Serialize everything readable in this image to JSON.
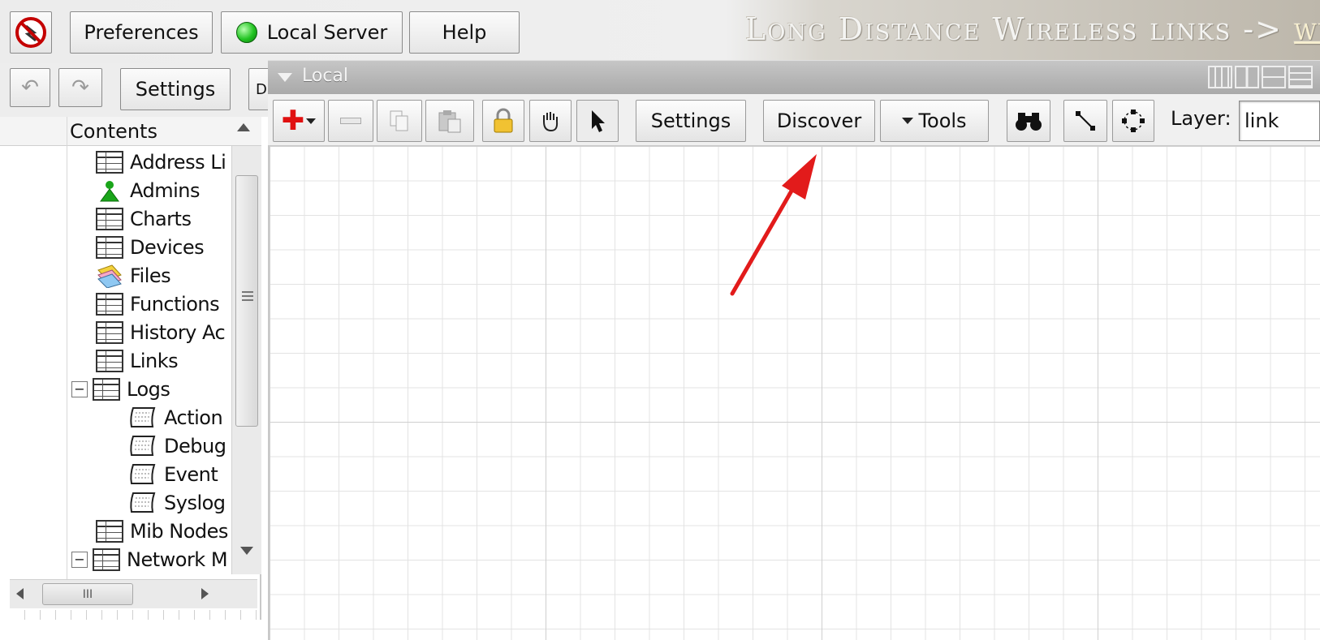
{
  "topbar": {
    "preferences_label": "Preferences",
    "server_label": "Local Server",
    "help_label": "Help",
    "banner_text": "Long Distance Wireless links -> ",
    "banner_link": "www"
  },
  "toolbar2": {
    "settings_label": "Settings",
    "cut_char": "D"
  },
  "tree": {
    "header": "Contents",
    "items": [
      {
        "label": "Address Li",
        "icon": "table-icon"
      },
      {
        "label": "Admins",
        "icon": "admin-icon"
      },
      {
        "label": "Charts",
        "icon": "table-icon"
      },
      {
        "label": "Devices",
        "icon": "table-icon"
      },
      {
        "label": "Files",
        "icon": "files-icon"
      },
      {
        "label": "Functions",
        "icon": "table-icon"
      },
      {
        "label": "History Ac",
        "icon": "table-icon"
      },
      {
        "label": "Links",
        "icon": "table-icon"
      },
      {
        "label": "Logs",
        "icon": "table-icon"
      },
      {
        "label": "Action",
        "icon": "log-icon"
      },
      {
        "label": "Debug",
        "icon": "log-icon"
      },
      {
        "label": "Event",
        "icon": "log-icon"
      },
      {
        "label": "Syslog",
        "icon": "log-icon"
      },
      {
        "label": "Mib Nodes",
        "icon": "table-icon"
      },
      {
        "label": "Network M",
        "icon": "table-icon"
      }
    ],
    "expand_minus": "−",
    "hscroll_grip": "III"
  },
  "map": {
    "title": "Local",
    "settings_label": "Settings",
    "discover_label": "Discover",
    "tools_label": "Tools",
    "layer_label": "Layer:",
    "layer_value": "link"
  },
  "colors": {
    "arrow": "#e21b1b",
    "server_status": "#22c422"
  }
}
